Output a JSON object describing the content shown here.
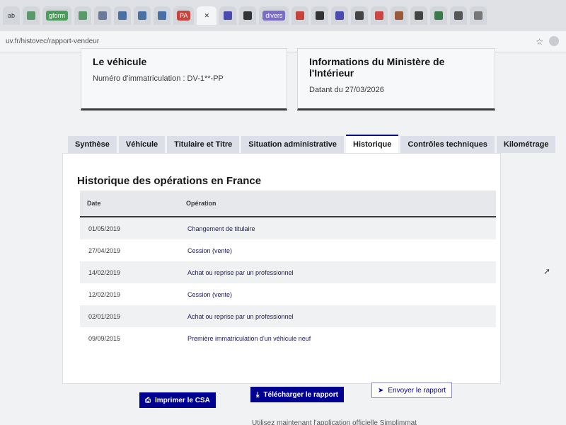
{
  "browser": {
    "tabs": [
      {
        "label": "ab",
        "kind": "plain"
      },
      {
        "label": "",
        "kind": "plain"
      },
      {
        "label": "gform",
        "kind": "chip"
      },
      {
        "label": "",
        "kind": "plain"
      },
      {
        "label": "",
        "kind": "plain"
      },
      {
        "label": "",
        "kind": "plain"
      },
      {
        "label": "",
        "kind": "plain"
      },
      {
        "label": "",
        "kind": "plain"
      },
      {
        "label": "PA",
        "kind": "red"
      },
      {
        "label": "✕",
        "kind": "active"
      },
      {
        "label": "",
        "kind": "plain"
      },
      {
        "label": "",
        "kind": "plain"
      },
      {
        "label": "divers",
        "kind": "chip2"
      },
      {
        "label": "",
        "kind": "plain"
      },
      {
        "label": "",
        "kind": "plain"
      },
      {
        "label": "",
        "kind": "plain"
      },
      {
        "label": "",
        "kind": "plain"
      },
      {
        "label": "",
        "kind": "plain"
      },
      {
        "label": "",
        "kind": "plain"
      },
      {
        "label": "",
        "kind": "plain"
      },
      {
        "label": "",
        "kind": "plain"
      },
      {
        "label": "",
        "kind": "plain"
      },
      {
        "label": "",
        "kind": "plain"
      }
    ],
    "url": "uv.fr/histovec/rapport-vendeur"
  },
  "cards": {
    "vehicle": {
      "title": "Le véhicule",
      "line": "Numéro d'immatriculation : DV-1**-PP"
    },
    "ministry": {
      "title": "Informations du Ministère de l'Intérieur",
      "line": "Datant du 27/03/2026"
    }
  },
  "tabs": [
    {
      "label": "Synthèse",
      "active": false
    },
    {
      "label": "Véhicule",
      "active": false
    },
    {
      "label": "Titulaire et Titre",
      "active": false
    },
    {
      "label": "Situation administrative",
      "active": false
    },
    {
      "label": "Historique",
      "active": true
    },
    {
      "label": "Contrôles techniques",
      "active": false
    },
    {
      "label": "Kilométrage",
      "active": false
    }
  ],
  "history": {
    "title": "Historique des opérations en France",
    "columns": {
      "date": "Date",
      "operation": "Opération"
    },
    "rows": [
      {
        "date": "01/05/2019",
        "operation": "Changement de titulaire"
      },
      {
        "date": "27/04/2019",
        "operation": "Cession (vente)"
      },
      {
        "date": "14/02/2019",
        "operation": "Achat ou reprise par un professionnel"
      },
      {
        "date": "12/02/2019",
        "operation": "Cession (vente)"
      },
      {
        "date": "02/01/2019",
        "operation": "Achat ou reprise par un professionnel"
      },
      {
        "date": "09/09/2015",
        "operation": "Première immatriculation d'un véhicule neuf"
      }
    ]
  },
  "actions": {
    "print": "Imprimer le CSA",
    "download": "Télécharger le rapport",
    "send": "Envoyer le rapport"
  },
  "footer": {
    "note": "Utilisez maintenant l'application officielle Simplimmat"
  },
  "colors": {
    "primary": "#000091",
    "tab_inactive": "#dcdfe8"
  }
}
